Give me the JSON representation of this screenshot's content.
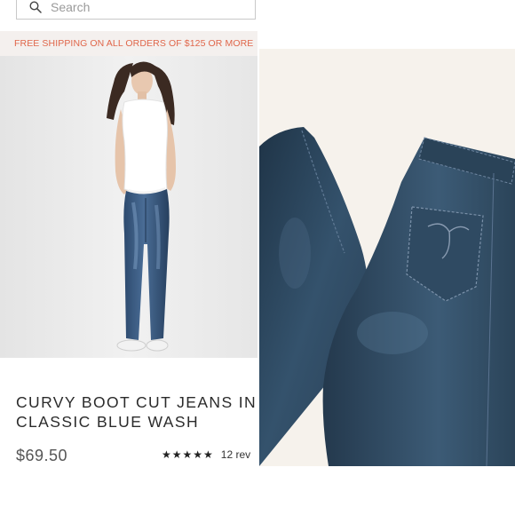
{
  "search": {
    "placeholder": "Search",
    "icon": "search-icon"
  },
  "promo": {
    "text": "FREE SHIPPING ON ALL ORDERS OF $125 OR MORE",
    "color": "#e0664a"
  },
  "product": {
    "title_line1": "CURVY BOOT CUT JEANS IN",
    "title_line2": "CLASSIC BLUE WASH",
    "price": "$69.50",
    "stars": "★★★★★",
    "rating": 5,
    "reviews": "12 rev"
  },
  "colors": {
    "denim": "#2c4257",
    "background_photo": "#ededed",
    "background_right": "#f6f2ec"
  }
}
